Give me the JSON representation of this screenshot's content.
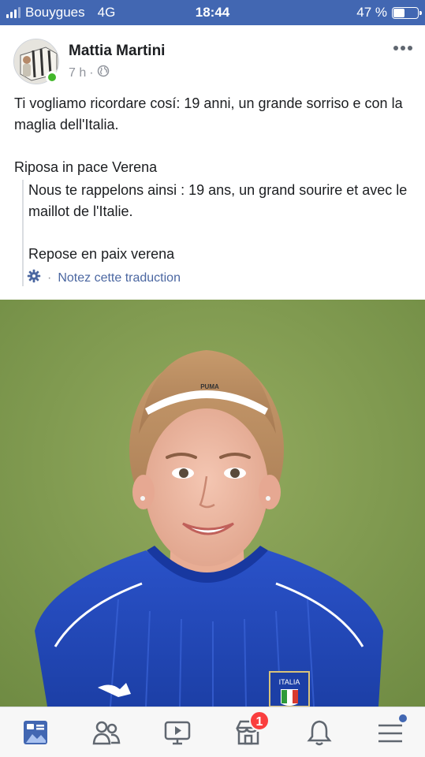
{
  "status_bar": {
    "carrier": "Bouygues",
    "network": "4G",
    "time": "18:44",
    "battery_percent_text": "47 %",
    "battery_level": 0.47,
    "color": "#4267b2"
  },
  "post": {
    "author": "Mattia Martini",
    "time": "7 h",
    "audience_icon": "globe-icon",
    "more_icon": "more-dots-icon",
    "text": [
      "Ti vogliamo ricordare cosí: 19 anni, un grande sorriso e con la maglia dell'Italia.",
      "Riposa in pace Verena"
    ],
    "translation": [
      "Nous te rappelons ainsi : 19 ans, un grand sourire et avec le maillot de l'Italie.",
      "Repose en paix verena"
    ],
    "rate_translation_label": "Notez cette traduction",
    "rate_icon": "gear-icon",
    "photo": {
      "shirt_label": "ITALIA",
      "headband_label": "PUMA"
    }
  },
  "bottom_nav": {
    "items": [
      {
        "icon": "news-feed-icon",
        "active": true
      },
      {
        "icon": "friends-icon",
        "active": false
      },
      {
        "icon": "watch-icon",
        "active": false
      },
      {
        "icon": "marketplace-icon",
        "active": false
      },
      {
        "icon": "bell-icon",
        "active": false
      },
      {
        "icon": "menu-icon",
        "active": false
      }
    ],
    "marketplace_badge": "1",
    "accent": "#4267b2",
    "badge_color": "#fa3e3e"
  }
}
